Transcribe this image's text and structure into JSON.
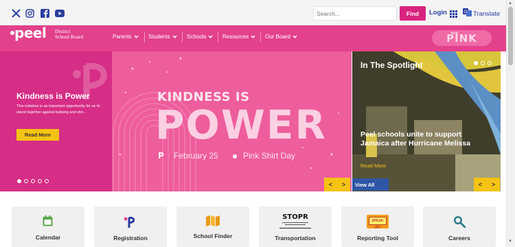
{
  "topbar": {
    "social": [
      {
        "icon": "x-twitter-icon"
      },
      {
        "icon": "instagram-icon"
      },
      {
        "icon": "facebook-icon"
      },
      {
        "icon": "youtube-icon"
      }
    ],
    "search_placeholder": "Search...",
    "find_label": "Find",
    "login_label": "Login",
    "apps_icon": "grid-icon",
    "translate_label": "Translate"
  },
  "brand": {
    "wordmark": "peel",
    "subtitle_line1": "District",
    "subtitle_line2": "School Board"
  },
  "nav": {
    "items": [
      {
        "label": "Parents"
      },
      {
        "label": "Students"
      },
      {
        "label": "Schools"
      },
      {
        "label": "Resources"
      },
      {
        "label": "Our Board"
      }
    ],
    "badge_small": "think",
    "badge_word": "PINK"
  },
  "hero": {
    "title": "Kindness is Power",
    "description": "This initiative is an important opportunity for us to stand together against bullying and sho...",
    "read_more": "Read More",
    "slide_count": 5,
    "active_slide": 0,
    "banner_line1": "KINDNESS IS",
    "banner_line2": "POWER",
    "banner_logo": "P",
    "banner_date": "February 25",
    "banner_event": "Pink Shirt Day",
    "prev_arrow": "<",
    "next_arrow": ">"
  },
  "spotlight": {
    "heading": "In The Spotlight",
    "title": "Peel schools unite to support Jamaica after Hurricane Melissa",
    "read_more": "Read More",
    "view_all": "View All",
    "slide_count": 3,
    "active_slide": 0,
    "prev_arrow": "<",
    "next_arrow": ">"
  },
  "quick_links": [
    {
      "label": "Calendar",
      "icon": "calendar-icon"
    },
    {
      "label": "Registration",
      "icon": "peel-p-icon"
    },
    {
      "label": "School Finder",
      "icon": "map-icon"
    },
    {
      "label": "Transportation",
      "icon": "stopr-logo",
      "logo_text": "STOPR"
    },
    {
      "label": "Reporting Tool",
      "icon": "speak-up-icon",
      "logo_text": "SPEAK UP!"
    },
    {
      "label": "Careers",
      "icon": "magnifier-icon"
    }
  ],
  "colors": {
    "brand_pink": "#e3418b",
    "hero_pink": "#d62d86",
    "accent_yellow": "#f5c313",
    "link_blue": "#2b3f9e",
    "find_pink": "#d9247f",
    "view_all_blue": "#2f56a6"
  }
}
